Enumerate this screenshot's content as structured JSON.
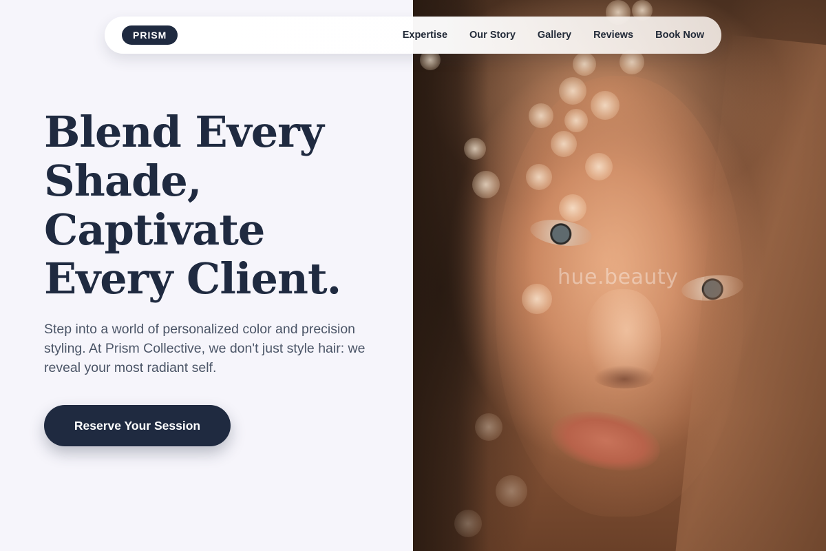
{
  "brand": {
    "logo_text": "PRISM"
  },
  "nav": {
    "links": [
      "Expertise",
      "Our Story",
      "Gallery",
      "Reviews",
      "Book Now"
    ]
  },
  "hero": {
    "headline_lines": [
      "Blend Every",
      "Shade,",
      "Captivate",
      "Every Client."
    ],
    "subtext": "Step into a world of personalized color and precision styling. At Prism Collective, we don't just style hair: we reveal your most radiant self.",
    "cta_label": "Reserve Your Session"
  },
  "photo": {
    "watermark": "hue.beauty"
  },
  "colors": {
    "navy": "#1f2a40",
    "background": "#f6f5fb",
    "body_text": "#4b5567"
  }
}
